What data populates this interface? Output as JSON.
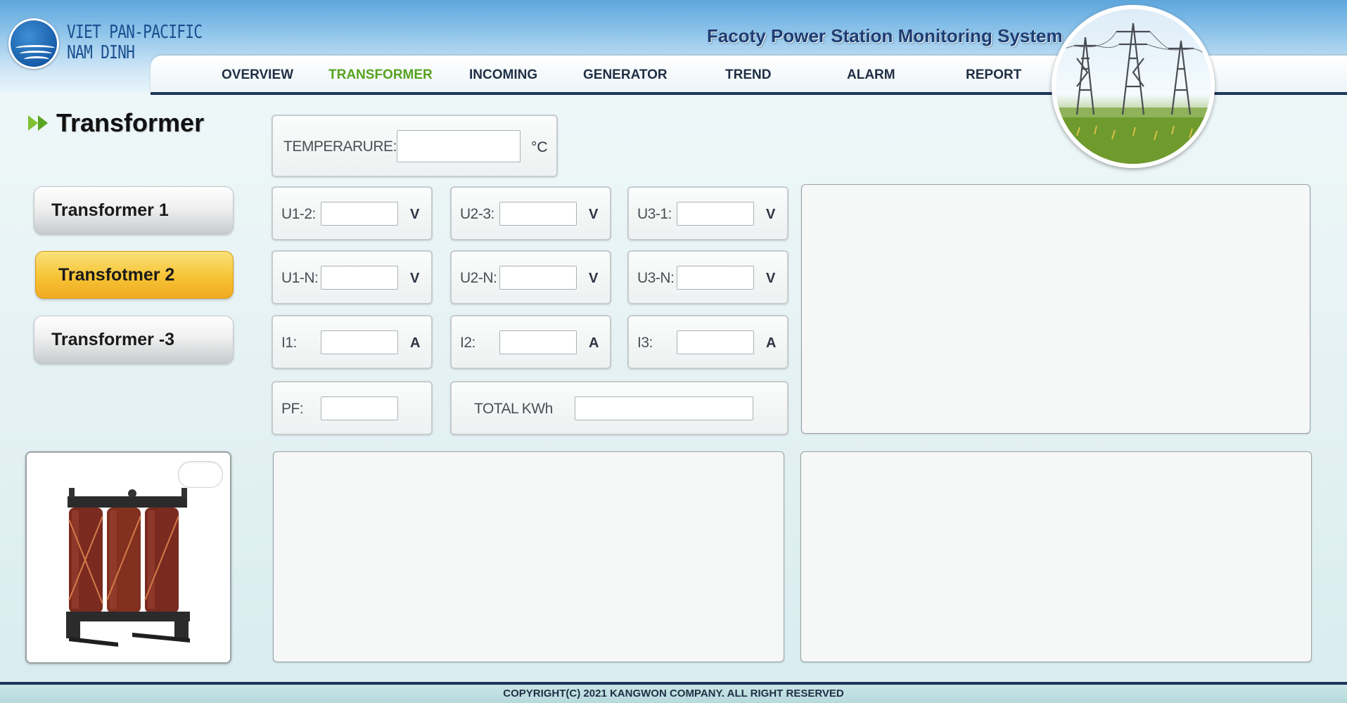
{
  "header": {
    "logo_line1": "VIET PAN-PACIFIC",
    "logo_line2": "NAM DINH",
    "system_title": "Facoty Power Station Monitoring System"
  },
  "nav": {
    "items": [
      {
        "label": "OVERVIEW"
      },
      {
        "label": "TRANSFORMER",
        "active": true
      },
      {
        "label": "INCOMING"
      },
      {
        "label": "GENERATOR"
      },
      {
        "label": "TREND"
      },
      {
        "label": "ALARM"
      },
      {
        "label": "REPORT"
      }
    ]
  },
  "section": {
    "title": "Transformer"
  },
  "transformers": [
    {
      "label": "Transformer 1"
    },
    {
      "label": "Transfotmer 2",
      "active": true
    },
    {
      "label": "Transformer -3"
    }
  ],
  "temperature": {
    "label": "TEMPERARURE:",
    "unit": "°C",
    "value": ""
  },
  "voltage_ll": [
    {
      "label": "U1-2:",
      "unit": "V",
      "value": ""
    },
    {
      "label": "U2-3:",
      "unit": "V",
      "value": ""
    },
    {
      "label": "U3-1:",
      "unit": "V",
      "value": ""
    }
  ],
  "voltage_ln": [
    {
      "label": "U1-N:",
      "unit": "V",
      "value": ""
    },
    {
      "label": "U2-N:",
      "unit": "V",
      "value": ""
    },
    {
      "label": "U3-N:",
      "unit": "V",
      "value": ""
    }
  ],
  "current": [
    {
      "label": "I1:",
      "unit": "A",
      "value": ""
    },
    {
      "label": "I2:",
      "unit": "A",
      "value": ""
    },
    {
      "label": "I3:",
      "unit": "A",
      "value": ""
    }
  ],
  "pf": {
    "label": "PF:",
    "value": ""
  },
  "total_kwh": {
    "label": "TOTAL KWh",
    "value": ""
  },
  "colors": {
    "accent_active_nav": "#56a321",
    "active_button": "#f6c334",
    "dark_rule": "#1d3658"
  },
  "icons": [
    "double-chevron-right-icon",
    "transformer-image",
    "power-pylon-image",
    "company-logo"
  ],
  "footer": {
    "copyright": "COPYRIGHT(C) 2021 KANGWON COMPANY. ALL RIGHT RESERVED"
  }
}
